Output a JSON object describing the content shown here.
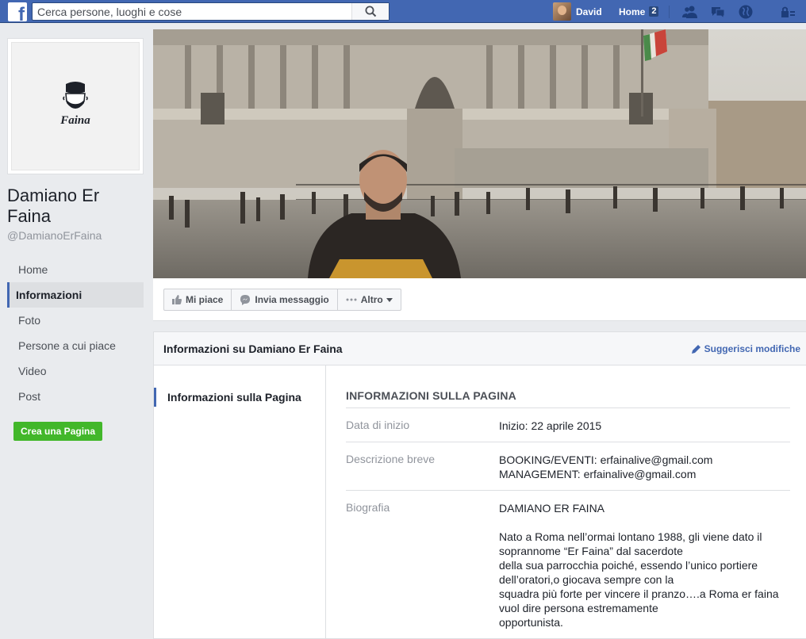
{
  "topbar": {
    "search_placeholder": "Cerca persone, luoghi e cose",
    "user_name": "David",
    "home_label": "Home",
    "home_count": "2",
    "brand_color": "#4267b2"
  },
  "page": {
    "name": "Damiano Er Faina",
    "handle": "@DamianoErFaina",
    "logo_text": "Faina"
  },
  "nav": {
    "items": [
      {
        "label": "Home"
      },
      {
        "label": "Informazioni"
      },
      {
        "label": "Foto"
      },
      {
        "label": "Persone a cui piace"
      },
      {
        "label": "Video"
      },
      {
        "label": "Post"
      }
    ],
    "create_page": "Crea una Pagina"
  },
  "actions": {
    "like": "Mi piace",
    "message": "Invia messaggio",
    "more": "Altro"
  },
  "about": {
    "title": "Informazioni su Damiano Er Faina",
    "suggest": "Suggerisci modifiche",
    "side_item": "Informazioni sulla Pagina",
    "section_heading": "INFORMAZIONI SULLA PAGINA",
    "rows": [
      {
        "label": "Data di inizio",
        "value": "Inizio: 22 aprile 2015"
      },
      {
        "label": "Descrizione breve",
        "value": "BOOKING/EVENTI: erfainalive@gmail.com\nMANAGEMENT: erfainalive@gmail.com"
      },
      {
        "label": "Biografia",
        "value": "DAMIANO ER FAINA\n\nNato a Roma nell’ormai lontano 1988, gli viene dato il\nsoprannome “Er Faina” dal sacerdote\ndella sua parrocchia poiché, essendo l’unico portiere\ndell’oratori,o giocava sempre con la\nsquadra più forte per vincere il pranzo….a Roma er faina\nvuol dire persona estremamente\nopportunista."
      }
    ]
  }
}
